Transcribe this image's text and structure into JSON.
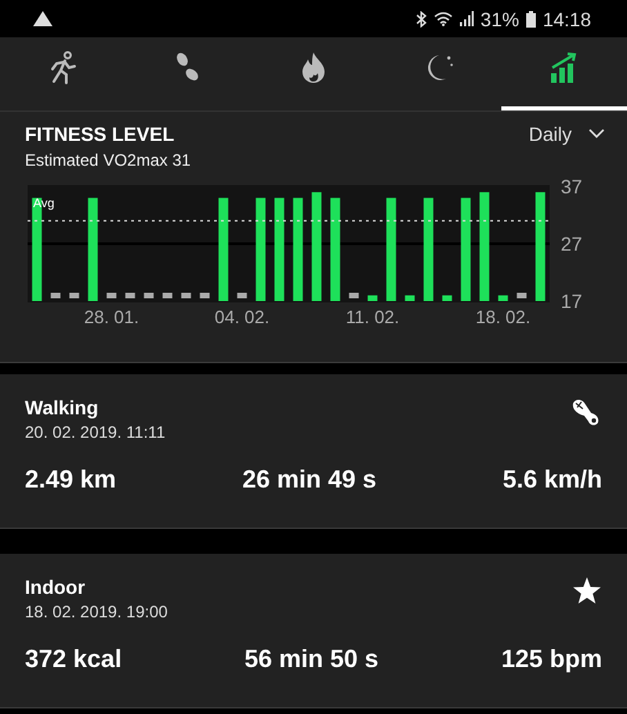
{
  "status_bar": {
    "battery": "31%",
    "time": "14:18"
  },
  "tabs": [
    {
      "kind": "running",
      "selected": false
    },
    {
      "kind": "steps",
      "selected": false
    },
    {
      "kind": "calories",
      "selected": false
    },
    {
      "kind": "sleep",
      "selected": false
    },
    {
      "kind": "fitness",
      "selected": true
    }
  ],
  "fitness": {
    "title": "FITNESS LEVEL",
    "subtitle": "Estimated VO2max 31",
    "period": "Daily",
    "chart_data": {
      "type": "bar",
      "categories": [
        null,
        null,
        null,
        null,
        "28. 01.",
        null,
        null,
        null,
        null,
        null,
        null,
        "04. 02.",
        null,
        null,
        null,
        null,
        null,
        null,
        "11. 02.",
        null,
        null,
        null,
        null,
        null,
        null,
        "18. 02.",
        null,
        null
      ],
      "series": [
        {
          "color": "#1ee05a",
          "values": [
            35,
            null,
            null,
            35,
            null,
            null,
            null,
            null,
            null,
            null,
            35,
            null,
            35,
            35,
            35,
            36,
            35,
            null,
            18,
            35,
            18,
            35,
            18,
            35,
            36,
            18,
            null,
            36
          ]
        }
      ],
      "ylim": [
        17,
        37
      ],
      "yticks": [
        17,
        27,
        37
      ],
      "ref_lines": [
        {
          "axis": "y",
          "value": 31,
          "label": "Avg"
        }
      ]
    }
  },
  "activities": [
    {
      "kind": "walking",
      "title": "Walking",
      "date": "20. 02. 2019. 11:11",
      "stats": [
        "2.49 km",
        "26 min 49 s",
        "5.6 km/h"
      ]
    },
    {
      "kind": "indoor",
      "title": "Indoor",
      "date": "18. 02. 2019. 19:00",
      "stats": [
        "372 kcal",
        "56 min 50 s",
        "125 bpm"
      ]
    }
  ]
}
